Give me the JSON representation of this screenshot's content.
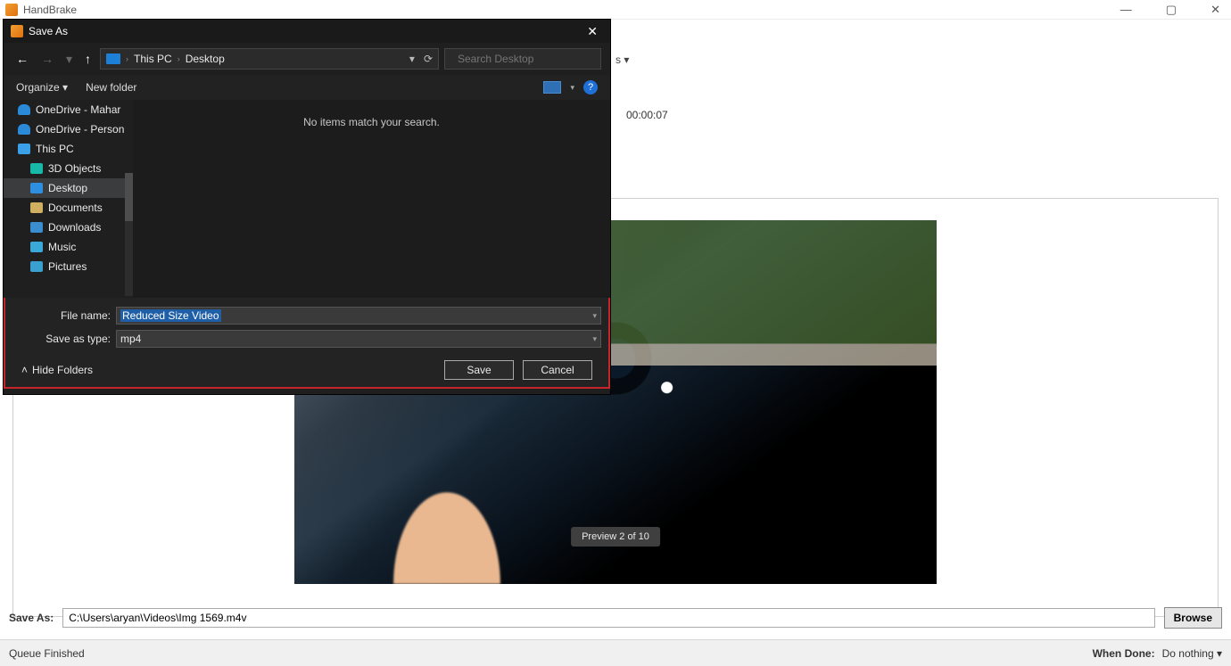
{
  "app": {
    "title": "HandBrake"
  },
  "window_controls": {
    "min": "—",
    "max": "▢",
    "close": "✕"
  },
  "bg": {
    "tab_trail": "s   ▾",
    "duration": "00:00:07",
    "preview_label": "Preview 2 of 10",
    "prev": "<",
    "next": ">"
  },
  "save_row": {
    "label": "Save As:",
    "path": "C:\\Users\\aryan\\Videos\\Img 1569.m4v",
    "browse": "Browse"
  },
  "status": {
    "left": "Queue Finished",
    "whendone_label": "When Done:",
    "whendone_value": "Do nothing ▾"
  },
  "dialog": {
    "title": "Save As",
    "close": "✕",
    "nav": {
      "back": "←",
      "forward": "→",
      "recent": "▾",
      "up": "↑"
    },
    "breadcrumb": {
      "pc": "This PC",
      "sep": "›",
      "loc": "Desktop",
      "refresh": "⟳",
      "dd": "▾"
    },
    "search_placeholder": "Search Desktop",
    "toolbar": {
      "organize": "Organize ▾",
      "newfolder": "New folder",
      "view_dd": "▾",
      "help": "?"
    },
    "tree": {
      "onedrive_m": "OneDrive - Mahar",
      "onedrive_p": "OneDrive - Person",
      "thispc": "This PC",
      "threed": "3D Objects",
      "desktop": "Desktop",
      "documents": "Documents",
      "downloads": "Downloads",
      "music": "Music",
      "pictures": "Pictures"
    },
    "empty": "No items match your search.",
    "filename_label": "File name:",
    "filename_value": "Reduced Size Video",
    "savetype_label": "Save as type:",
    "savetype_value": "mp4",
    "hide_folders": "Hide Folders",
    "save": "Save",
    "cancel": "Cancel"
  }
}
